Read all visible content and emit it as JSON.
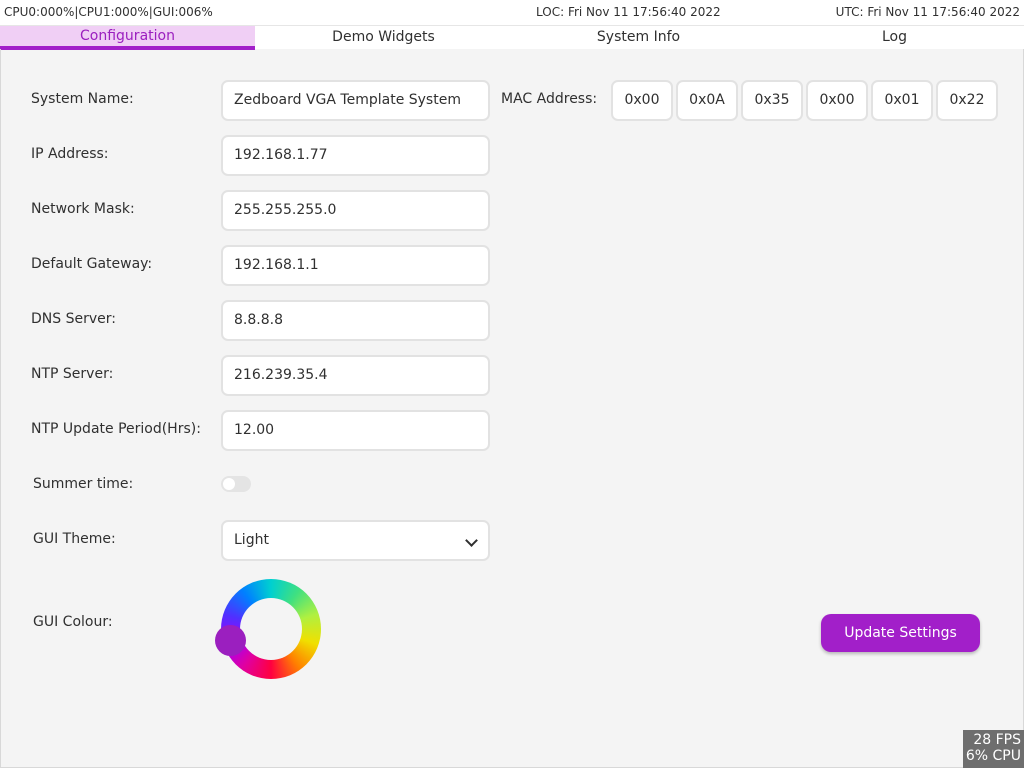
{
  "status": {
    "cpu": "CPU0:000%|CPU1:000%|GUI:006%",
    "loc": "LOC: Fri Nov 11 17:56:40 2022",
    "utc": "UTC: Fri Nov 11 17:56:40 2022"
  },
  "tabs": [
    {
      "label": "Configuration",
      "active": true
    },
    {
      "label": "Demo Widgets",
      "active": false
    },
    {
      "label": "System Info",
      "active": false
    },
    {
      "label": "Log",
      "active": false
    }
  ],
  "form": {
    "system_name": {
      "label": "System Name:",
      "value": "Zedboard VGA Template System"
    },
    "mac_address": {
      "label": "MAC Address:",
      "octets": [
        "0x00",
        "0x0A",
        "0x35",
        "0x00",
        "0x01",
        "0x22"
      ]
    },
    "ip_address": {
      "label": "IP Address:",
      "value": "192.168.1.77"
    },
    "network_mask": {
      "label": "Network Mask:",
      "value": "255.255.255.0"
    },
    "default_gateway": {
      "label": "Default Gateway:",
      "value": "192.168.1.1"
    },
    "dns_server": {
      "label": "DNS Server:",
      "value": "8.8.8.8"
    },
    "ntp_server": {
      "label": "NTP Server:",
      "value": "216.239.35.4"
    },
    "ntp_period": {
      "label": "NTP Update Period(Hrs):",
      "value": "12.00"
    },
    "summer_time": {
      "label": "Summer time:",
      "enabled": false
    },
    "gui_theme": {
      "label": "GUI Theme:",
      "value": "Light"
    },
    "gui_colour": {
      "label": "GUI Colour:",
      "selected_color": "#9b1fbf"
    }
  },
  "update_button": {
    "label": "Update Settings"
  },
  "perf": {
    "fps": "28 FPS",
    "cpu": "6% CPU"
  },
  "colors": {
    "accent": "#a21fc9",
    "tab_active_bg": "#f0cff5",
    "background": "#f4f4f4"
  }
}
